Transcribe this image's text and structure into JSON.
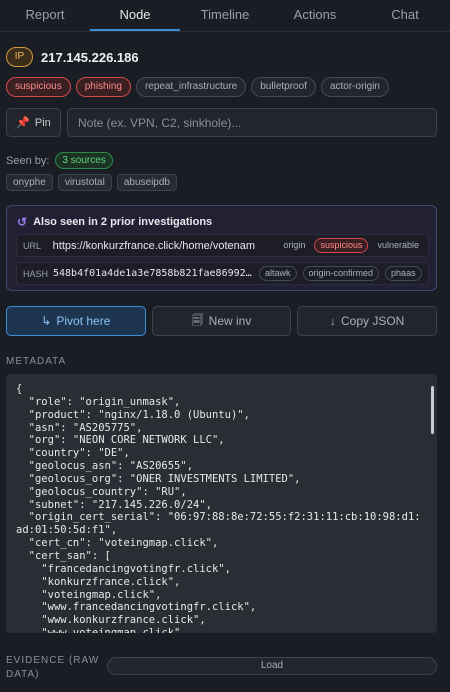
{
  "tabs": [
    {
      "label": "Report",
      "active": false
    },
    {
      "label": "Node",
      "active": true
    },
    {
      "label": "Timeline",
      "active": false
    },
    {
      "label": "Actions",
      "active": false
    },
    {
      "label": "Chat",
      "active": false
    }
  ],
  "node": {
    "type_badge": "IP",
    "ip": "217.145.226.186",
    "tags": [
      {
        "label": "suspicious",
        "style": "red"
      },
      {
        "label": "phishing",
        "style": "red"
      },
      {
        "label": "repeat_infrastructure",
        "style": "gray"
      },
      {
        "label": "bulletproof",
        "style": "gray"
      },
      {
        "label": "actor-origin",
        "style": "gray"
      }
    ]
  },
  "pin": {
    "label": "Pin",
    "icon": "pushpin-icon",
    "note_placeholder": "Note (ex. VPN, C2, sinkhole)..."
  },
  "seen_by": {
    "label": "Seen by:",
    "count_badge": "3 sources",
    "sources": [
      "onyphe",
      "virustotal",
      "abuseipdb"
    ]
  },
  "also_seen": {
    "title": "Also seen in 2 prior investigations",
    "icon": "cycle-icon",
    "rows": [
      {
        "kind": "URL",
        "value": "https://konkurzfrance.click/home/votenam",
        "chips": [
          {
            "label": "origin",
            "style": "plain"
          },
          {
            "label": "suspicious",
            "style": "red"
          },
          {
            "label": "vulnerable",
            "style": "plain"
          }
        ]
      },
      {
        "kind": "HASH",
        "value": "548b4f01a4de1a3e7858b821fae869922...",
        "chips": [
          {
            "label": "altawk",
            "style": "gray"
          },
          {
            "label": "origin-confirmed",
            "style": "gray"
          },
          {
            "label": "phaas",
            "style": "gray"
          }
        ]
      }
    ]
  },
  "actions": {
    "pivot": {
      "icon": "↳",
      "label": "Pivot here"
    },
    "new_inv": {
      "icon": "🗐",
      "label": "New inv"
    },
    "copy_json": {
      "icon": "↓",
      "label": "Copy JSON"
    }
  },
  "metadata": {
    "heading": "METADATA",
    "json_text": "{\n  \"role\": \"origin_unmask\",\n  \"product\": \"nginx/1.18.0 (Ubuntu)\",\n  \"asn\": \"AS205775\",\n  \"org\": \"NEON CORE NETWORK LLC\",\n  \"country\": \"DE\",\n  \"geolocus_asn\": \"AS20655\",\n  \"geolocus_org\": \"ONER INVESTMENTS LIMITED\",\n  \"geolocus_country\": \"RU\",\n  \"subnet\": \"217.145.226.0/24\",\n  \"origin_cert_serial\": \"06:97:88:8e:72:55:f2:31:11:cb:10:98:d1:ad:01:50:5d:f1\",\n  \"cert_cn\": \"voteingmap.click\",\n  \"cert_san\": [\n    \"francedancingvotingfr.click\",\n    \"konkurzfrance.click\",\n    \"voteingmap.click\",\n    \"www.francedancingvotingfr.click\",\n    \"www.konkurzfrance.click\",\n    \"www.voteingmap.click\""
  },
  "evidence": {
    "heading": "EVIDENCE (RAW DATA)",
    "load_label": "Load"
  }
}
